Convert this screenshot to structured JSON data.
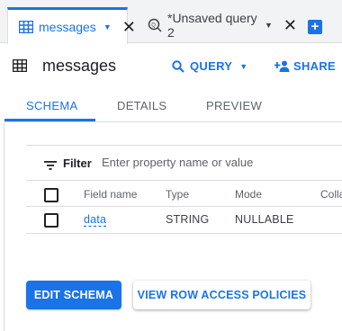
{
  "tabs": [
    {
      "label": "messages",
      "icon": "table-icon",
      "active": true
    },
    {
      "label": "*Unsaved query 2",
      "icon": "query-icon",
      "active": false
    }
  ],
  "header": {
    "title": "messages",
    "query_label": "QUERY",
    "share_label": "SHARE"
  },
  "subtabs": {
    "schema": "SCHEMA",
    "details": "DETAILS",
    "preview": "PREVIEW"
  },
  "filter": {
    "label": "Filter",
    "placeholder": "Enter property name or value"
  },
  "schema_table": {
    "columns": [
      "Field name",
      "Type",
      "Mode",
      "Colla"
    ],
    "rows": [
      {
        "name": "data",
        "type": "STRING",
        "mode": "NULLABLE"
      }
    ]
  },
  "actions": {
    "edit_schema": "EDIT SCHEMA",
    "row_access": "VIEW ROW ACCESS POLICIES"
  },
  "colors": {
    "accent": "#1a73e8",
    "text": "#202124",
    "muted": "#5f6368",
    "border": "#dadce0"
  }
}
